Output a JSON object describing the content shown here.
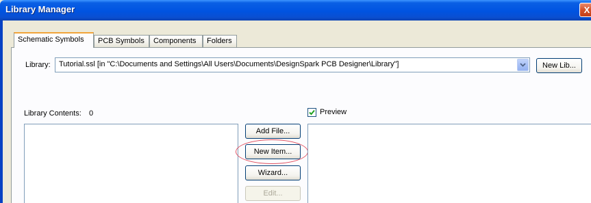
{
  "window": {
    "title": "Library Manager",
    "close_glyph": "X"
  },
  "tabs": [
    {
      "label": "Schematic Symbols"
    },
    {
      "label": "PCB Symbols"
    },
    {
      "label": "Components"
    },
    {
      "label": "Folders"
    }
  ],
  "library": {
    "label": "Library:",
    "selected": "Tutorial.ssl   [in \"C:\\Documents and Settings\\All Users\\Documents\\DesignSpark PCB Designer\\Library\"]",
    "new_lib_button": "New Lib..."
  },
  "contents": {
    "label": "Library Contents:",
    "count": "0"
  },
  "buttons": {
    "add_file": "Add File...",
    "new_item": "New Item...",
    "wizard": "Wizard...",
    "edit": "Edit..."
  },
  "preview": {
    "label": "Preview",
    "checked": true
  },
  "icons": {
    "close": "close-icon",
    "combo_arrow": "chevron-down-icon",
    "check": "checkmark-icon"
  },
  "colors": {
    "titlebar": "#0053e1",
    "dialog_bg": "#ece9d8",
    "highlight_oval": "#e05060",
    "active_tab_accent": "#f1a439"
  }
}
